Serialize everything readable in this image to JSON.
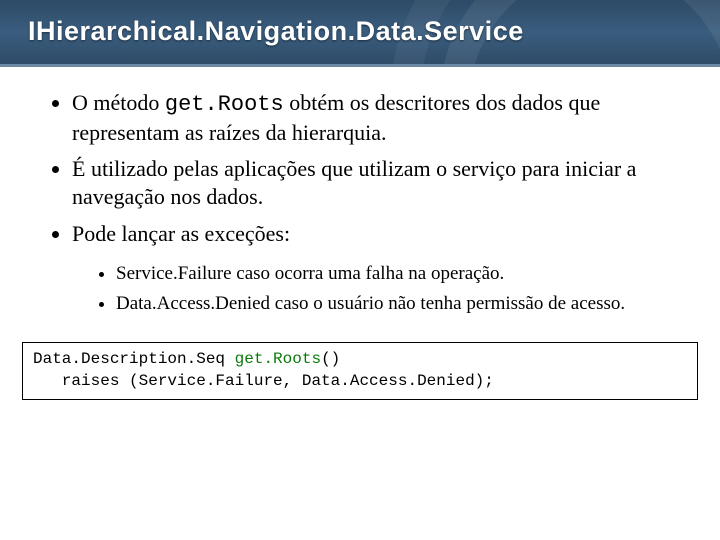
{
  "title": "IHierarchical.Navigation.Data.Service",
  "bullets": {
    "b1_pre": "O método ",
    "b1_code": "get.Roots",
    "b1_post": " obtém os descritores dos dados que representam as raízes da hierarquia.",
    "b2": "É utilizado pelas aplicações que utilizam o serviço para iniciar a navegação nos dados.",
    "b3": "Pode lançar as exceções:",
    "sub1": "Service.Failure caso ocorra uma falha na operação.",
    "sub2": "Data.Access.Denied caso o usuário não tenha permissão de acesso."
  },
  "code": {
    "line1a": "Data.Description.Seq ",
    "line1b": "get.Roots",
    "line1c": "()",
    "line2": "   raises (Service.Failure, Data.Access.Denied);"
  }
}
